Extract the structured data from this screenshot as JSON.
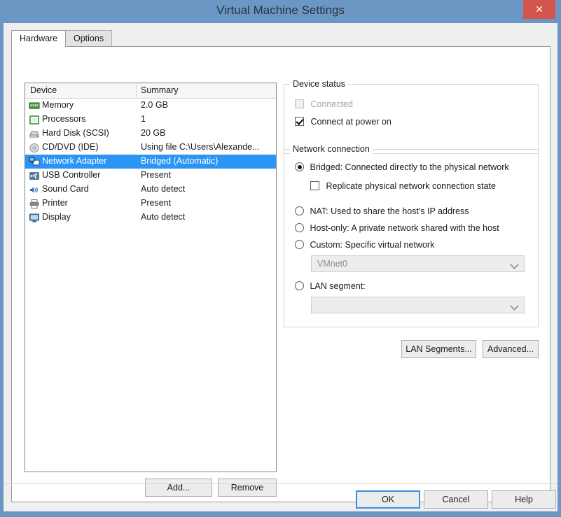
{
  "window": {
    "title": "Virtual Machine Settings",
    "close_label": "✕"
  },
  "tabs": [
    {
      "label": "Hardware",
      "active": true
    },
    {
      "label": "Options",
      "active": false
    }
  ],
  "device_list": {
    "columns": [
      "Device",
      "Summary"
    ],
    "rows": [
      {
        "icon": "memory-icon",
        "device": "Memory",
        "summary": "2.0 GB",
        "selected": false
      },
      {
        "icon": "processor-icon",
        "device": "Processors",
        "summary": "1",
        "selected": false
      },
      {
        "icon": "hard-disk-icon",
        "device": "Hard Disk (SCSI)",
        "summary": "20 GB",
        "selected": false
      },
      {
        "icon": "cd-dvd-icon",
        "device": "CD/DVD (IDE)",
        "summary": "Using file C:\\Users\\Alexande...",
        "selected": false
      },
      {
        "icon": "network-adapter-icon",
        "device": "Network Adapter",
        "summary": "Bridged (Automatic)",
        "selected": true
      },
      {
        "icon": "usb-controller-icon",
        "device": "USB Controller",
        "summary": "Present",
        "selected": false
      },
      {
        "icon": "sound-card-icon",
        "device": "Sound Card",
        "summary": "Auto detect",
        "selected": false
      },
      {
        "icon": "printer-icon",
        "device": "Printer",
        "summary": "Present",
        "selected": false
      },
      {
        "icon": "display-icon",
        "device": "Display",
        "summary": "Auto detect",
        "selected": false
      }
    ],
    "add_label": "Add...",
    "remove_label": "Remove"
  },
  "device_status": {
    "legend": "Device status",
    "connected_label": "Connected",
    "connected_checked": false,
    "connected_disabled": true,
    "connect_at_power_on_label": "Connect at power on",
    "connect_at_power_on_checked": true
  },
  "network_connection": {
    "legend": "Network connection",
    "options": [
      {
        "label": "Bridged: Connected directly to the physical network",
        "selected": true
      },
      {
        "label": "NAT: Used to share the host's IP address",
        "selected": false
      },
      {
        "label": "Host-only: A private network shared with the host",
        "selected": false
      },
      {
        "label": "Custom: Specific virtual network",
        "selected": false
      },
      {
        "label": "LAN segment:",
        "selected": false
      }
    ],
    "replicate_label": "Replicate physical network connection state",
    "replicate_checked": false,
    "custom_network_value": "VMnet0",
    "lan_segment_value": "",
    "lan_segments_button": "LAN Segments...",
    "advanced_button": "Advanced..."
  },
  "dialog_buttons": {
    "ok": "OK",
    "cancel": "Cancel",
    "help": "Help"
  },
  "colors": {
    "titlebar": "#6c96c4",
    "close_button": "#d2564e",
    "selection": "#2a95f5",
    "dialog_bg": "#efefef",
    "panel_bg": "#ffffff",
    "default_button_border": "#3a8de0"
  }
}
